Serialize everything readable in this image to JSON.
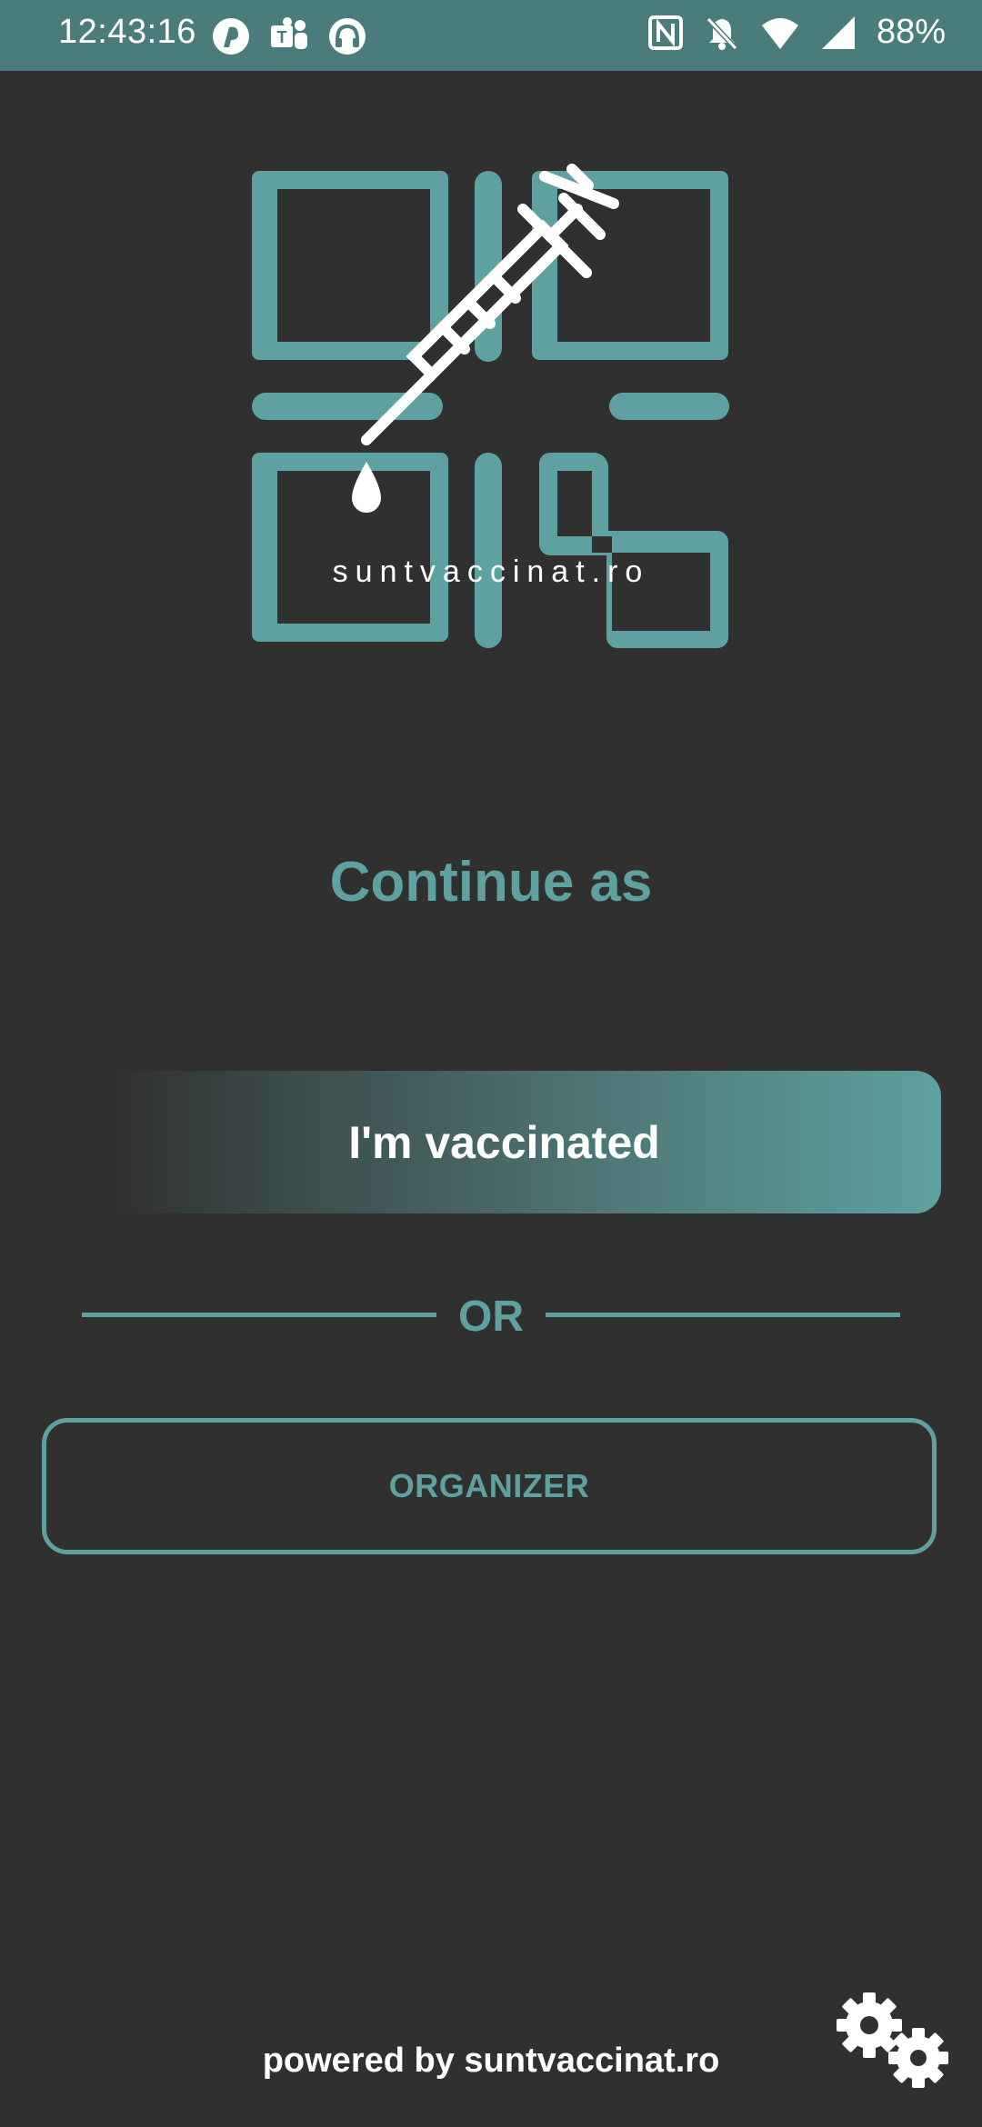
{
  "status_bar": {
    "time": "12:43:16",
    "battery": "88%",
    "left_icons": [
      "app-notification-icon",
      "teams-icon",
      "headset-icon"
    ],
    "right_icons": [
      "nfc-icon",
      "bell-off-icon",
      "wifi-icon",
      "signal-icon"
    ],
    "color": "#4a7c7b"
  },
  "logo": {
    "text": "suntvaccinat.ro",
    "color": "#5fa0a0"
  },
  "main": {
    "title": "Continue as",
    "primary_button_label": "I'm vaccinated",
    "divider_text": "OR",
    "secondary_button_label": "ORGANIZER"
  },
  "footer": {
    "powered_by": "powered by suntvaccinat.ro",
    "settings_icon": "gears-icon"
  },
  "colors": {
    "background": "#303030",
    "accent": "#5fa0a0",
    "text": "#ffffff"
  }
}
